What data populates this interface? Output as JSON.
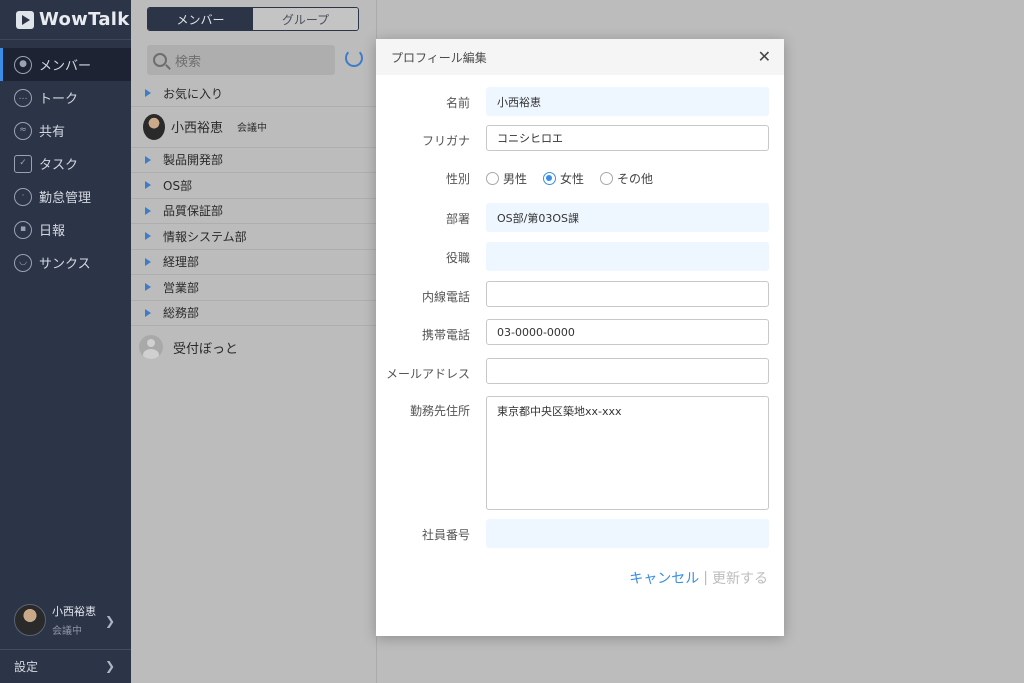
{
  "app": {
    "logo_text": "WowTalk"
  },
  "sidebar": {
    "items": [
      {
        "label": "メンバー",
        "icon": "person-circle-icon",
        "active": true
      },
      {
        "label": "トーク",
        "icon": "chat-bubble-icon",
        "active": false
      },
      {
        "label": "共有",
        "icon": "share-icon",
        "active": false
      },
      {
        "label": "タスク",
        "icon": "clipboard-icon",
        "active": false
      },
      {
        "label": "勤怠管理",
        "icon": "clock-icon",
        "active": false
      },
      {
        "label": "日報",
        "icon": "report-icon",
        "active": false
      },
      {
        "label": "サンクス",
        "icon": "smile-icon",
        "active": false
      }
    ],
    "user": {
      "name": "小西裕恵",
      "status": "会議中"
    },
    "settings_label": "設定"
  },
  "panel": {
    "tabs": {
      "members": "メンバー",
      "groups": "グループ"
    },
    "search": {
      "placeholder": "検索"
    },
    "favorites_label": "お気に入り",
    "member": {
      "name": "小西裕恵",
      "status": "会議中"
    },
    "groups": [
      "製品開発部",
      "OS部",
      "品質保証部",
      "情報システム部",
      "経理部",
      "営業部",
      "総務部"
    ],
    "bot": {
      "name": "受付ぼっと"
    }
  },
  "modal": {
    "title": "プロフィール編集",
    "fields": {
      "name": {
        "label": "名前",
        "value": "小西裕恵"
      },
      "furigana": {
        "label": "フリガナ",
        "value": "コニシヒロエ"
      },
      "gender": {
        "label": "性別",
        "options": [
          "男性",
          "女性",
          "その他"
        ],
        "selected": "女性"
      },
      "department": {
        "label": "部署",
        "value": "OS部/第03OS課"
      },
      "position": {
        "label": "役職",
        "value": ""
      },
      "extension": {
        "label": "内線電話",
        "value": ""
      },
      "mobile": {
        "label": "携帯電話",
        "value": "03-0000-0000"
      },
      "email": {
        "label": "メールアドレス",
        "value": ""
      },
      "address": {
        "label": "勤務先住所",
        "value": "東京都中央区築地xx-xxx"
      },
      "employee_no": {
        "label": "社員番号",
        "value": ""
      }
    },
    "actions": {
      "cancel": "キャンセル",
      "separator": "|",
      "update": "更新する"
    }
  },
  "colors": {
    "sidebar_bg": "#2c3447",
    "accent": "#3a8ee6",
    "readonly_bg": "#eef6ff"
  }
}
